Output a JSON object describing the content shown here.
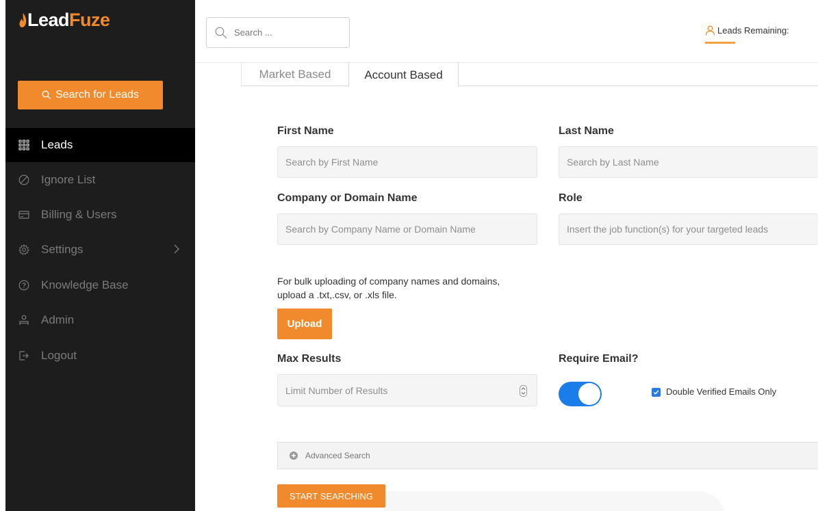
{
  "brand": {
    "lead": "Lead",
    "fuze": "Fuze",
    "accent": "#f08a2c"
  },
  "sidebar": {
    "search_button": "Search for Leads",
    "items": [
      {
        "label": "Leads",
        "icon": "grid-icon",
        "active": true
      },
      {
        "label": "Ignore List",
        "icon": "ban-icon"
      },
      {
        "label": "Billing & Users",
        "icon": "card-icon"
      },
      {
        "label": "Settings",
        "icon": "gear-icon"
      },
      {
        "label": "Knowledge Base",
        "icon": "question-icon"
      },
      {
        "label": "Admin",
        "icon": "admin-icon"
      },
      {
        "label": "Logout",
        "icon": "logout-icon"
      }
    ]
  },
  "header": {
    "search_placeholder": "Search ...",
    "leads_remaining": "Leads Remaining:"
  },
  "tabs": [
    {
      "label": "Market Based",
      "active": false
    },
    {
      "label": "Account Based",
      "active": true
    }
  ],
  "form": {
    "first_name_label": "First Name",
    "first_name_placeholder": "Search by First Name",
    "last_name_label": "Last Name",
    "last_name_placeholder": "Search by Last Name",
    "company_label": "Company or Domain Name",
    "company_placeholder": "Search by Company Name or Domain Name",
    "role_label": "Role",
    "role_placeholder": "Insert the job function(s) for your targeted leads",
    "bulk_text": "For bulk uploading of company names and domains, upload a .txt,.csv, or .xls file.",
    "upload_button": "Upload",
    "max_results_label": "Max Results",
    "max_results_placeholder": "Limit Number of Results",
    "require_email_label": "Require Email?",
    "require_email_on": true,
    "double_verified_label": "Double Verified Emails Only",
    "double_verified_checked": true,
    "advanced_search": "Advanced Search",
    "start_button": "START SEARCHING"
  }
}
